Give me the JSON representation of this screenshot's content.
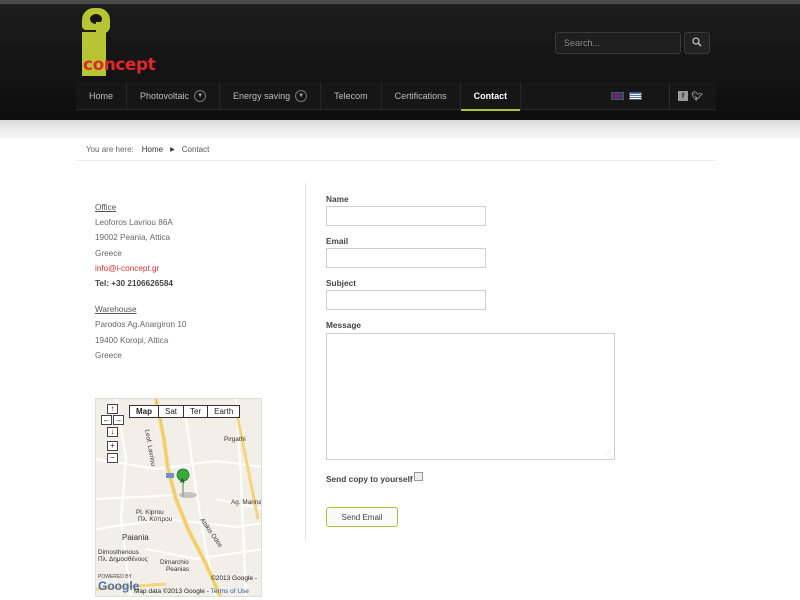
{
  "header": {
    "logo_text": "concept",
    "search": {
      "placeholder": "Search..."
    }
  },
  "nav": {
    "items": [
      {
        "label": "Home",
        "has_arrow": false
      },
      {
        "label": "Photovoltaic",
        "has_arrow": true
      },
      {
        "label": "Energy saving",
        "has_arrow": true
      },
      {
        "label": "Telecom",
        "has_arrow": false
      },
      {
        "label": "Certifications",
        "has_arrow": false
      },
      {
        "label": "Contact",
        "has_arrow": false,
        "active": true
      }
    ],
    "languages": [
      "uk-flag-icon",
      "greece-flag-icon"
    ],
    "social": [
      "facebook-icon",
      "twitter-icon"
    ]
  },
  "breadcrumb": {
    "prefix": "You are here:",
    "home": "Home",
    "current": "Contact"
  },
  "office": {
    "heading": "Office",
    "line1": "Leoforos Lavriou 86A",
    "line2": "19002 Peania, Attica",
    "line3": "Greece",
    "email": "info@i-concept.gr",
    "tel": "Tel: +30 2106626584"
  },
  "warehouse": {
    "heading": "Warehouse",
    "line1": "Parodos Ag.Anargiron 10",
    "line2": "19400 Koropi, Attica",
    "line3": "Greece"
  },
  "map": {
    "types": [
      "Map",
      "Sat",
      "Ter",
      "Earth"
    ],
    "labels": {
      "lavriou": "Leof. Lavriou",
      "pirgathi": "Pirgathi",
      "marina": "Ag. Marina",
      "kiprou": "Pl. Kiprou",
      "kiprou_gr": "Πλ. Κύπρου",
      "paiania": "Paiania",
      "dimosthenous": "Dimosthenous",
      "dimosthenous_gr": "Πλ. Δημοσθένους",
      "dimarchio": "Dimarchio",
      "peanias": "Peanias",
      "attikis": "Attikis Odos",
      "marker": "A"
    },
    "powered": "POWERED BY",
    "google": "Google",
    "copyright": "©2013 Google -",
    "data_text": "Map data ©2013 Google -",
    "terms": "Terms of Use"
  },
  "form": {
    "name_label": "Name",
    "email_label": "Email",
    "subject_label": "Subject",
    "message_label": "Message",
    "copy_label": "Send copy to yourself",
    "send_label": "Send Email"
  },
  "colors": {
    "accent_green": "#a8c23a",
    "email_red": "#d23232",
    "header_dark": "#151515"
  }
}
